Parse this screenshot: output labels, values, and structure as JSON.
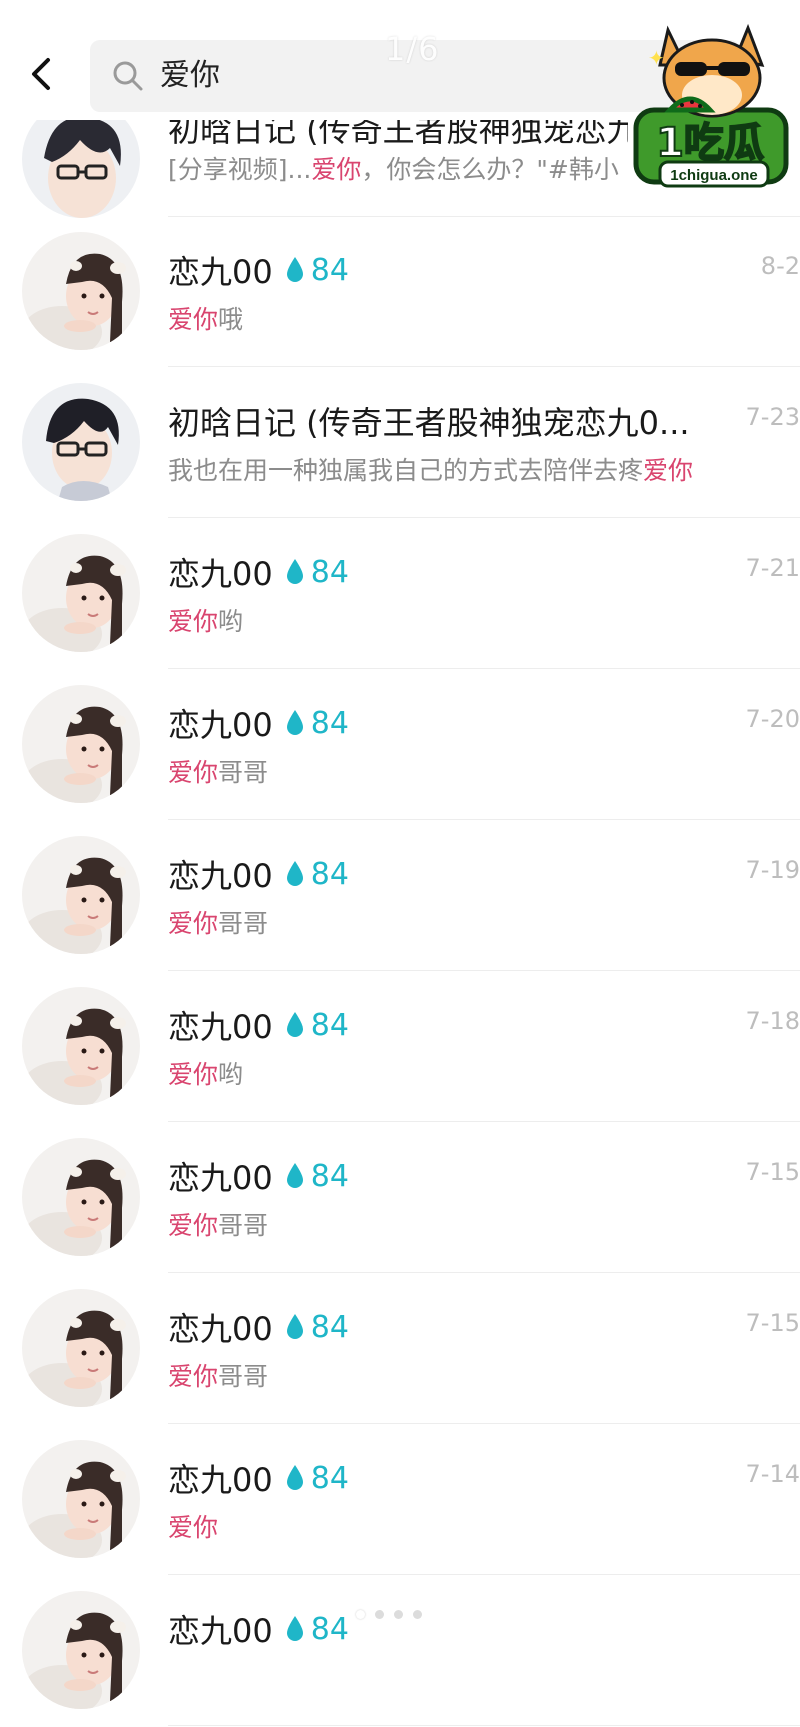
{
  "header": {
    "query": "爱你",
    "pager": "1/6"
  },
  "watermark": {
    "brand_text": "1吃瓜",
    "domain": "1chigua.one"
  },
  "partial_row": {
    "title": "初晗日记 (传奇王者股神独宠恋九",
    "preview_prefix": "[分享视频]...",
    "preview_highlight": "爱你",
    "preview_suffix": "，你会怎么办？\"#韩小"
  },
  "rows": [
    {
      "name": "恋九00",
      "badge": "84",
      "highlight": "爱你",
      "rest": "哦",
      "time": "8-2",
      "avatar": "girl"
    },
    {
      "name": "初晗日记 (传奇王者股神独宠恋九0...",
      "badge": "",
      "highlight": "爱你",
      "prefix": "我也在用一种独属我自己的方式去陪伴去疼",
      "rest": "",
      "time": "7-23",
      "avatar": "boy"
    },
    {
      "name": "恋九00",
      "badge": "84",
      "highlight": "爱你",
      "rest": "哟",
      "time": "7-21",
      "avatar": "girl"
    },
    {
      "name": "恋九00",
      "badge": "84",
      "highlight": "爱你",
      "rest": "哥哥",
      "time": "7-20",
      "avatar": "girl"
    },
    {
      "name": "恋九00",
      "badge": "84",
      "highlight": "爱你",
      "rest": "哥哥",
      "time": "7-19",
      "avatar": "girl"
    },
    {
      "name": "恋九00",
      "badge": "84",
      "highlight": "爱你",
      "rest": "哟",
      "time": "7-18",
      "avatar": "girl"
    },
    {
      "name": "恋九00",
      "badge": "84",
      "highlight": "爱你",
      "rest": "哥哥",
      "time": "7-15",
      "avatar": "girl"
    },
    {
      "name": "恋九00",
      "badge": "84",
      "highlight": "爱你",
      "rest": "哥哥",
      "time": "7-15",
      "avatar": "girl"
    },
    {
      "name": "恋九00",
      "badge": "84",
      "highlight": "爱你",
      "rest": "",
      "time": "7-14",
      "avatar": "girl"
    },
    {
      "name": "恋九00",
      "badge": "84",
      "highlight": "",
      "rest": "",
      "time": "",
      "avatar": "girl"
    }
  ],
  "colors": {
    "highlight": "#d9456f",
    "badge": "#1fb6c8",
    "preview": "#8c8c8c",
    "time": "#bdbdbd"
  }
}
